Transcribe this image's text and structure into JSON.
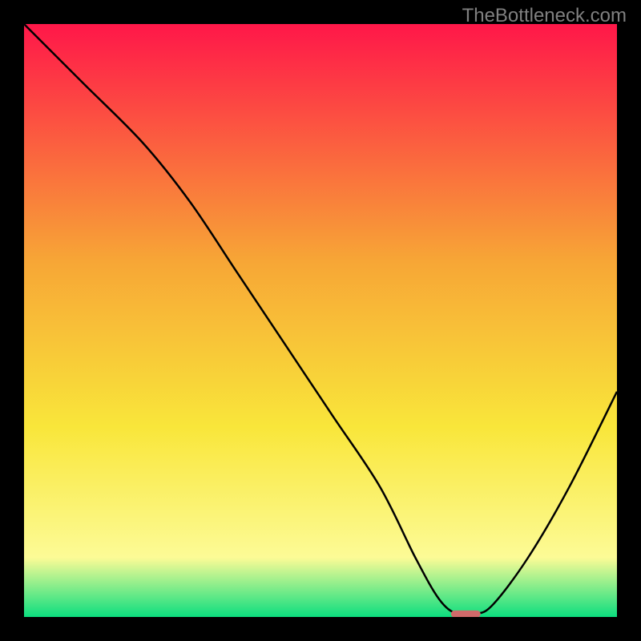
{
  "watermark": "TheBottleneck.com",
  "chart_data": {
    "type": "line",
    "title": "",
    "xlabel": "",
    "ylabel": "",
    "xlim": [
      0,
      100
    ],
    "ylim": [
      0,
      100
    ],
    "background_gradient": {
      "top": "#ff1749",
      "mid1": "#f7a636",
      "mid2": "#f9e63a",
      "mid3": "#fcfb96",
      "bottom": "#0cde7f"
    },
    "series": [
      {
        "name": "bottleneck-curve",
        "color": "#000000",
        "x": [
          0,
          10,
          20,
          28,
          36,
          44,
          52,
          60,
          66,
          70,
          73,
          76,
          79,
          85,
          92,
          100
        ],
        "values": [
          100,
          90,
          80,
          70,
          58,
          46,
          34,
          22,
          10,
          3,
          0.5,
          0.5,
          2,
          10,
          22,
          38
        ]
      }
    ],
    "marker": {
      "name": "optimal-point",
      "color": "#d06a6a",
      "x": 74.5,
      "y": 0.5,
      "width_pct": 5,
      "height_pct": 1.2
    }
  }
}
